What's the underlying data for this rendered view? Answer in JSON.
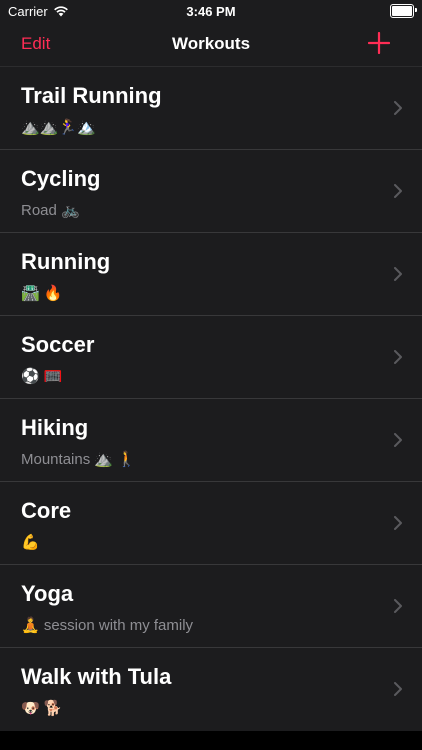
{
  "status_bar": {
    "carrier": "Carrier",
    "time": "3:46 PM",
    "battery_level": 1.0
  },
  "nav": {
    "edit_label": "Edit",
    "title": "Workouts",
    "add_icon": "plus-icon",
    "accent_color": "#ff2d55"
  },
  "workouts": [
    {
      "title": "Trail Running",
      "subtitle": "⛰️⛰️🏃‍♀️🏔️"
    },
    {
      "title": "Cycling",
      "subtitle": "Road 🚲"
    },
    {
      "title": "Running",
      "subtitle": "🛣️ 🔥"
    },
    {
      "title": "Soccer",
      "subtitle": " ⚽ 🥅"
    },
    {
      "title": "Hiking",
      "subtitle": "Mountains ⛰️ 🚶"
    },
    {
      "title": "Core",
      "subtitle": "💪"
    },
    {
      "title": "Yoga",
      "subtitle": "🧘 session with my family"
    },
    {
      "title": "Walk with Tula",
      "subtitle": "🐶 🐕"
    }
  ]
}
